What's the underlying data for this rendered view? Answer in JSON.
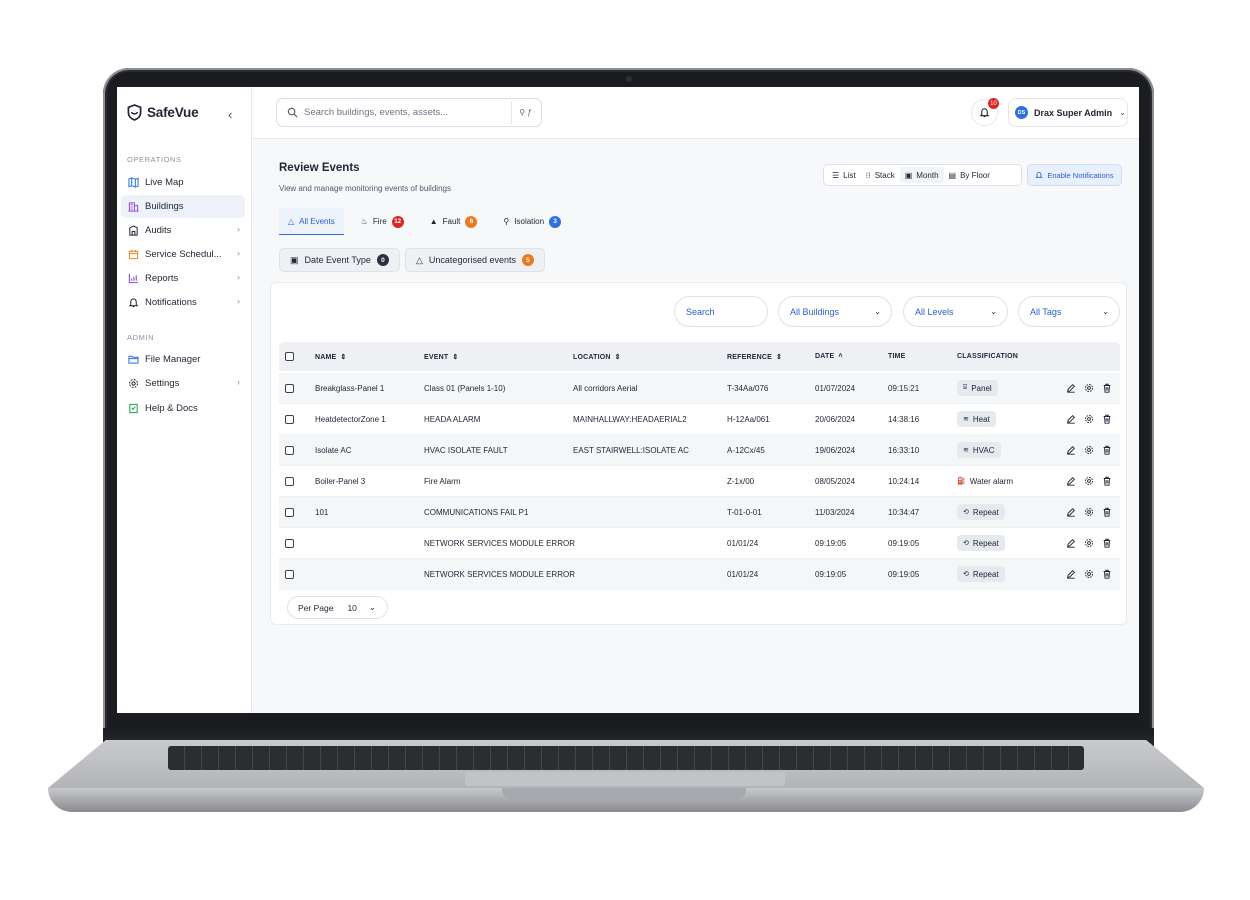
{
  "app": {
    "brand": "SafeVue",
    "collapse_icon": "chevron-left-icon"
  },
  "sidebar": {
    "sections": [
      {
        "label": "OPERATIONS",
        "items": [
          {
            "label": "Live Map",
            "icon": "map-icon",
            "chevron": false,
            "active": false
          },
          {
            "label": "Buildings",
            "icon": "building-icon",
            "chevron": false,
            "active": true
          },
          {
            "label": "Audits",
            "icon": "clipboard-icon",
            "chevron": true,
            "active": false
          },
          {
            "label": "Service Schedul...",
            "icon": "calendar-icon",
            "chevron": true,
            "active": false
          },
          {
            "label": "Reports",
            "icon": "chart-icon",
            "chevron": true,
            "active": false
          },
          {
            "label": "Notifications",
            "icon": "bell-icon",
            "chevron": true,
            "active": false
          }
        ]
      },
      {
        "label": "ADMIN",
        "items": [
          {
            "label": "File Manager",
            "icon": "folder-icon",
            "chevron": false,
            "active": false
          },
          {
            "label": "Settings",
            "icon": "gear-icon",
            "chevron": true,
            "active": false
          },
          {
            "label": "Help & Docs",
            "icon": "book-icon",
            "chevron": false,
            "active": false
          }
        ]
      }
    ]
  },
  "topbar": {
    "search_placeholder": "Search buildings, events, assets...",
    "filter_label": "⚲ ƒ",
    "notification_count": "10",
    "user_initials": "DS",
    "user_name": "Drax Super Admin"
  },
  "page": {
    "title": "Review Events",
    "subtitle": "View and manage monitoring events of buildings",
    "views": [
      "List",
      "Stack",
      "Month",
      "By Floor"
    ],
    "active_view": "Month",
    "enable_notifications": "Enable Notifications"
  },
  "tabs": [
    {
      "label": "All Events",
      "count": "",
      "color": "",
      "icon": "warning-outline-icon"
    },
    {
      "label": "Fire",
      "count": "12",
      "color": "#dc2626",
      "icon": "fire-icon"
    },
    {
      "label": "Fault",
      "count": "6",
      "color": "#ea7a1f",
      "icon": "warning-icon"
    },
    {
      "label": "Isolation",
      "count": "3",
      "color": "#2f6fe0",
      "icon": "isolation-icon"
    }
  ],
  "chips": [
    {
      "label": "Date Event Type",
      "count": "0",
      "color": "#2b3140",
      "icon": "calendar-icon"
    },
    {
      "label": "Uncategorised events",
      "count": "5",
      "color": "#ea7a1f",
      "icon": "warning-outline-icon"
    }
  ],
  "filters": {
    "search_placeholder": "Search",
    "buildings": "All Buildings",
    "levels": "All Levels",
    "tags": "All Tags"
  },
  "table": {
    "columns": [
      "NAME",
      "EVENT",
      "LOCATION",
      "REFERENCE",
      "DATE",
      "TIME",
      "CLASSIFICATION"
    ],
    "rows": [
      {
        "name": "Breakglass-Panel 1",
        "event": "Class 01 (Panels 1-10)",
        "location": "All corridors Aerial",
        "reference": "T-34Aa/076",
        "date": "01/07/2024",
        "time": "09:15:21",
        "classification": "Panel",
        "tag_icon": "panel-icon"
      },
      {
        "name": "HeatdetectorZone 1",
        "event": "HEADA ALARM",
        "location": "MAINHALLWAY:HEADAERIAL2",
        "reference": "H-12Aa/061",
        "date": "20/06/2024",
        "time": "14:38:16",
        "classification": "Heat",
        "tag_icon": "heat-icon"
      },
      {
        "name": "Isolate AC",
        "event": "HVAC ISOLATE FAULT",
        "location": "EAST STAIRWELL:ISOLATE AC",
        "reference": "A-12Cx/45",
        "date": "19/06/2024",
        "time": "16:33:10",
        "classification": "HVAC",
        "tag_icon": "hvac-icon"
      },
      {
        "name": "Boiler-Panel 3",
        "event": "Fire Alarm",
        "location": "",
        "reference": "Z-1x/00",
        "date": "08/05/2024",
        "time": "10:24:14",
        "classification": "Water alarm",
        "tag_icon": "water-icon"
      },
      {
        "name": "101",
        "event": "COMMUNICATIONS FAIL P1",
        "location": "",
        "reference": "T-01-0-01",
        "date": "11/03/2024",
        "time": "10:34:47",
        "classification": "Repeat",
        "tag_icon": "repeat-icon"
      },
      {
        "name": "",
        "event": "NETWORK SERVICES MODULE ERROR",
        "location": "",
        "reference": "01/01/24",
        "date": "09:19:05",
        "time": "09:19:05",
        "classification": "Repeat",
        "tag_icon": "repeat-icon"
      },
      {
        "name": "",
        "event": "NETWORK SERVICES MODULE ERROR",
        "location": "",
        "reference": "01/01/24",
        "date": "09:19:05",
        "time": "09:19:05",
        "classification": "Repeat",
        "tag_icon": "repeat-icon"
      }
    ]
  },
  "pagination": {
    "per_page_label": "Per Page",
    "per_page_value": "10"
  },
  "colors": {
    "accent": "#2f6fe0",
    "fire": "#dc2626",
    "fault": "#ea7a1f",
    "brand_icon": "#1e2533"
  }
}
